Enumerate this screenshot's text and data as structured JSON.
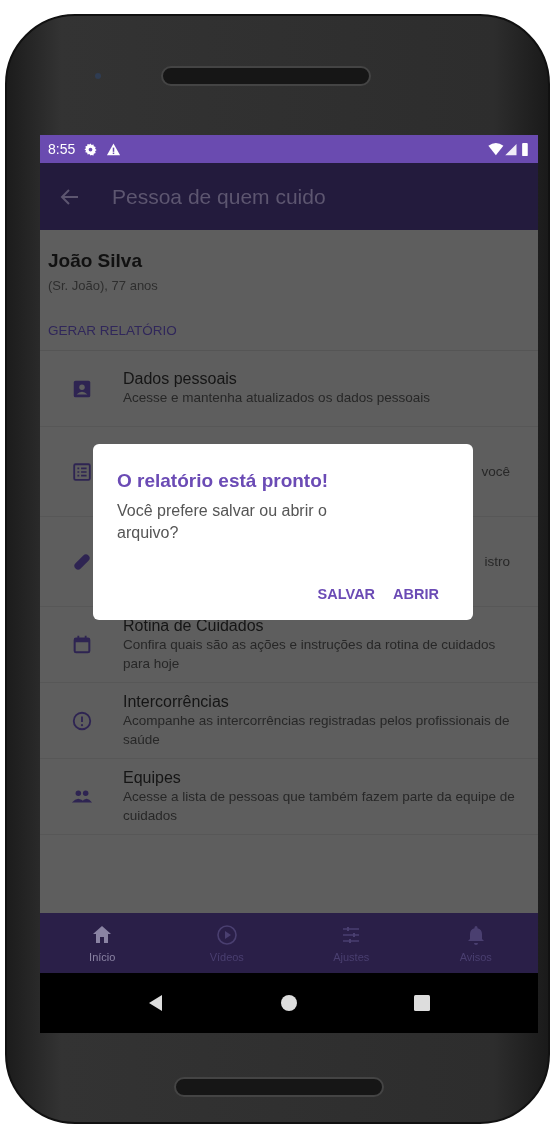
{
  "status_bar": {
    "time": "8:55"
  },
  "app_bar": {
    "title": "Pessoa de quem cuido"
  },
  "person": {
    "name": "João Silva",
    "details": "(Sr.  João), 77 anos"
  },
  "report_button": "GERAR RELATÓRIO",
  "menu_items": [
    {
      "kind": "person",
      "title": "Dados pessoais",
      "description": "Acesse e mantenha atualizados os dados pessoais"
    },
    {
      "kind": "list",
      "description": "você"
    },
    {
      "kind": "pill",
      "description": "istro"
    },
    {
      "kind": "calendar",
      "title": "Rotina de Cuidados",
      "description": "Confira quais são as ações e instruções da rotina de cuidados para hoje"
    },
    {
      "kind": "alert",
      "title": "Intercorrências",
      "description": "Acompanhe as intercorrências registradas pelos profissionais de saúde"
    },
    {
      "kind": "team",
      "title": "Equipes",
      "description": "Acesse a lista de pessoas que também fazem parte da equipe de cuidados"
    }
  ],
  "dialog": {
    "title": "O relatório está pronto!",
    "message": "Você prefere salvar ou abrir o arquivo?",
    "buttons": [
      "SALVAR",
      "ABRIR"
    ]
  },
  "bottom_nav": [
    {
      "kind": "home",
      "label": "Início",
      "selected": true
    },
    {
      "kind": "video",
      "label": "Vídeos",
      "selected": false
    },
    {
      "kind": "sliders",
      "label": "Ajustes",
      "selected": false
    },
    {
      "kind": "bell",
      "label": "Avisos",
      "selected": false
    }
  ]
}
